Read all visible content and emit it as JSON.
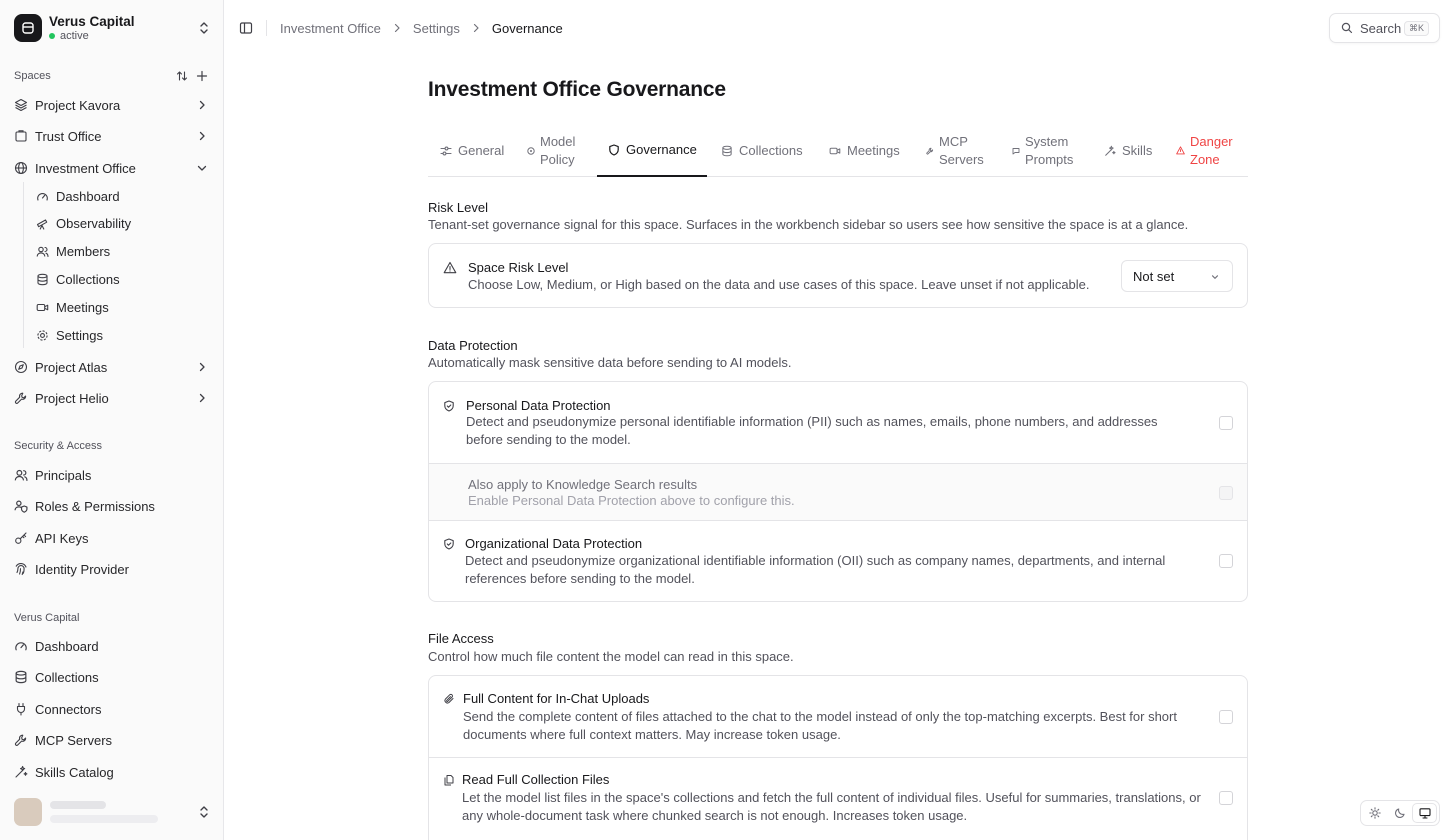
{
  "workspace": {
    "name": "Verus Capital",
    "status": "active"
  },
  "sidebar": {
    "spaces_label": "Spaces",
    "spaces": [
      {
        "label": "Project Kavora",
        "icon": "layers-icon"
      },
      {
        "label": "Trust Office",
        "icon": "building-icon"
      },
      {
        "label": "Investment Office",
        "icon": "globe-icon",
        "expanded": true,
        "children": [
          {
            "label": "Dashboard",
            "icon": "gauge-icon"
          },
          {
            "label": "Observability",
            "icon": "telescope-icon"
          },
          {
            "label": "Members",
            "icon": "users-icon"
          },
          {
            "label": "Collections",
            "icon": "database-icon"
          },
          {
            "label": "Meetings",
            "icon": "video-icon"
          },
          {
            "label": "Settings",
            "icon": "gear-icon"
          }
        ]
      },
      {
        "label": "Project Atlas",
        "icon": "compass-icon"
      },
      {
        "label": "Project Helio",
        "icon": "wrench-icon"
      }
    ],
    "security_label": "Security & Access",
    "security": [
      {
        "label": "Principals",
        "icon": "users-icon"
      },
      {
        "label": "Roles & Permissions",
        "icon": "shield-users-icon"
      },
      {
        "label": "API Keys",
        "icon": "key-icon"
      },
      {
        "label": "Identity Provider",
        "icon": "fingerprint-icon"
      }
    ],
    "org_label": "Verus Capital",
    "org": [
      {
        "label": "Dashboard",
        "icon": "gauge-icon"
      },
      {
        "label": "Collections",
        "icon": "database-icon"
      },
      {
        "label": "Connectors",
        "icon": "plug-icon"
      },
      {
        "label": "MCP Servers",
        "icon": "wrench-icon"
      },
      {
        "label": "Skills Catalog",
        "icon": "wand-icon"
      }
    ]
  },
  "breadcrumb": [
    "Investment Office",
    "Settings",
    "Governance"
  ],
  "search": {
    "label": "Search",
    "shortcut": "⌘K"
  },
  "page": {
    "title": "Investment Office Governance"
  },
  "tabs": [
    {
      "label": "General",
      "icon": "sliders-icon"
    },
    {
      "label": "Model Policy",
      "icon": "circle-dot-icon"
    },
    {
      "label": "Governance",
      "icon": "shield-icon",
      "active": true
    },
    {
      "label": "Collections",
      "icon": "database-icon"
    },
    {
      "label": "Meetings",
      "icon": "video-icon"
    },
    {
      "label": "MCP Servers",
      "icon": "wrench-icon"
    },
    {
      "label": "System Prompts",
      "icon": "message-icon"
    },
    {
      "label": "Skills",
      "icon": "wand-icon"
    },
    {
      "label": "Danger Zone",
      "icon": "warning-icon",
      "danger": true
    }
  ],
  "risk": {
    "title": "Risk Level",
    "desc": "Tenant-set governance signal for this space. Surfaces in the workbench sidebar so users see how sensitive the space is at a glance.",
    "item_title": "Space Risk Level",
    "item_desc": "Choose Low, Medium, or High based on the data and use cases of this space. Leave unset if not applicable.",
    "value": "Not set"
  },
  "data_protection": {
    "title": "Data Protection",
    "desc": "Automatically mask sensitive data before sending to AI models.",
    "items": [
      {
        "title": "Personal Data Protection",
        "desc": "Detect and pseudonymize personal identifiable information (PII) such as names, emails, phone numbers, and addresses before sending to the model."
      },
      {
        "title": "Also apply to Knowledge Search results",
        "desc": "Enable Personal Data Protection above to configure this."
      },
      {
        "title": "Organizational Data Protection",
        "desc": "Detect and pseudonymize organizational identifiable information (OII) such as company names, departments, and internal references before sending to the model."
      }
    ]
  },
  "file_access": {
    "title": "File Access",
    "desc": "Control how much file content the model can read in this space.",
    "items": [
      {
        "title": "Full Content for In-Chat Uploads",
        "desc": "Send the complete content of files attached to the chat to the model instead of only the top-matching excerpts. Best for short documents where full context matters. May increase token usage."
      },
      {
        "title": "Read Full Collection Files",
        "desc": "Let the model list files in the space's collections and fetch the full content of individual files. Useful for summaries, translations, or any whole-document task where chunked search is not enough. Increases token usage."
      }
    ]
  },
  "colors": {
    "accent": "#18181b",
    "danger": "#ef4444",
    "status_active": "#22c55e"
  }
}
